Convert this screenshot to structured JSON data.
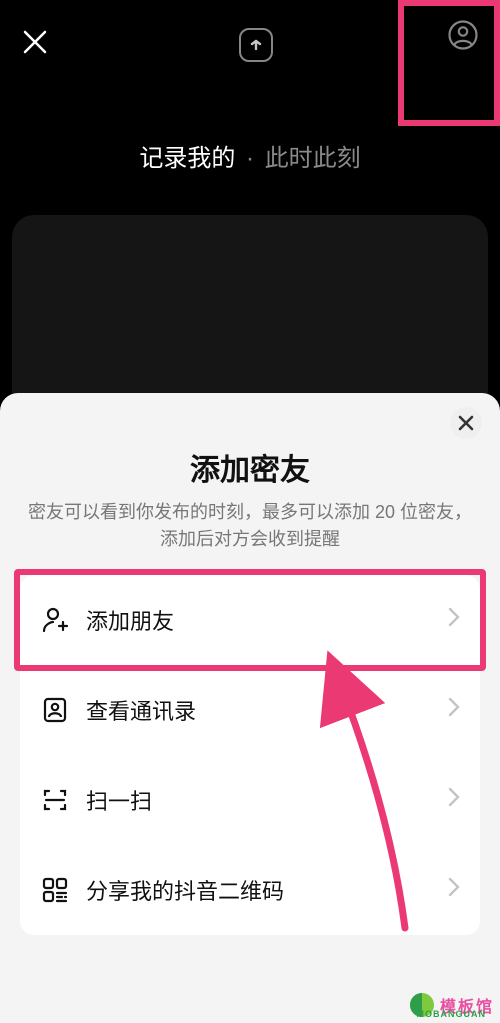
{
  "hero": {
    "left": "记录我的",
    "right": "此时此刻"
  },
  "sheet": {
    "title": "添加密友",
    "subtitle": "密友可以看到你发布的时刻，最多可以添加 20 位密友，添加后对方会收到提醒",
    "items": [
      {
        "label": "添加朋友"
      },
      {
        "label": "查看通讯录"
      },
      {
        "label": "扫一扫"
      },
      {
        "label": "分享我的抖音二维码"
      }
    ]
  },
  "watermark": {
    "cn": "模板馆",
    "en": "MOBANGUAN"
  }
}
